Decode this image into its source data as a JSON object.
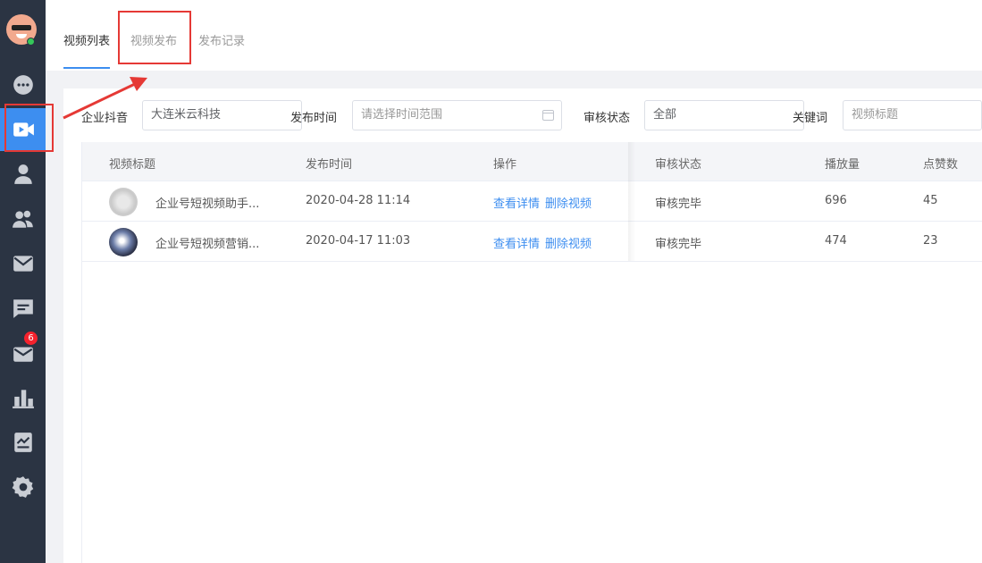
{
  "sidebar": {
    "badge_count": "6",
    "items": [
      {
        "icon": "chat-bubble-icon"
      },
      {
        "icon": "video-camera-icon",
        "active": true
      },
      {
        "icon": "user-icon"
      },
      {
        "icon": "users-icon"
      },
      {
        "icon": "mail-icon"
      },
      {
        "icon": "message-icon"
      },
      {
        "icon": "mail-open-icon"
      },
      {
        "icon": "bar-chart-icon"
      },
      {
        "icon": "report-icon"
      },
      {
        "icon": "gear-icon"
      }
    ]
  },
  "tabs": {
    "video_list": "视频列表",
    "video_publish": "视频发布",
    "publish_records": "发布记录"
  },
  "filters": {
    "enterprise_label": "企业抖音",
    "enterprise_value": "大连米云科技",
    "time_label": "发布时间",
    "time_placeholder": "请选择时间范围",
    "status_label": "审核状态",
    "status_value": "全部",
    "keyword_label": "关键词",
    "keyword_placeholder": "视频标题"
  },
  "table": {
    "headers": {
      "title": "视频标题",
      "time": "发布时间",
      "actions": "操作",
      "status": "审核状态",
      "plays": "播放量",
      "likes": "点赞数"
    },
    "rows": [
      {
        "title": "企业号短视频助手...",
        "time": "2020-04-28 11:14",
        "view": "查看详情",
        "delete": "删除视频",
        "status": "审核完毕",
        "plays": "696",
        "likes": "45"
      },
      {
        "title": "企业号短视频营销...",
        "time": "2020-04-17 11:03",
        "view": "查看详情",
        "delete": "删除视频",
        "status": "审核完毕",
        "plays": "474",
        "likes": "23"
      }
    ]
  },
  "colors": {
    "sidebar_bg": "#2b3443",
    "accent": "#3d8ef0",
    "annotation": "#e53935",
    "badge": "#f5222d"
  }
}
